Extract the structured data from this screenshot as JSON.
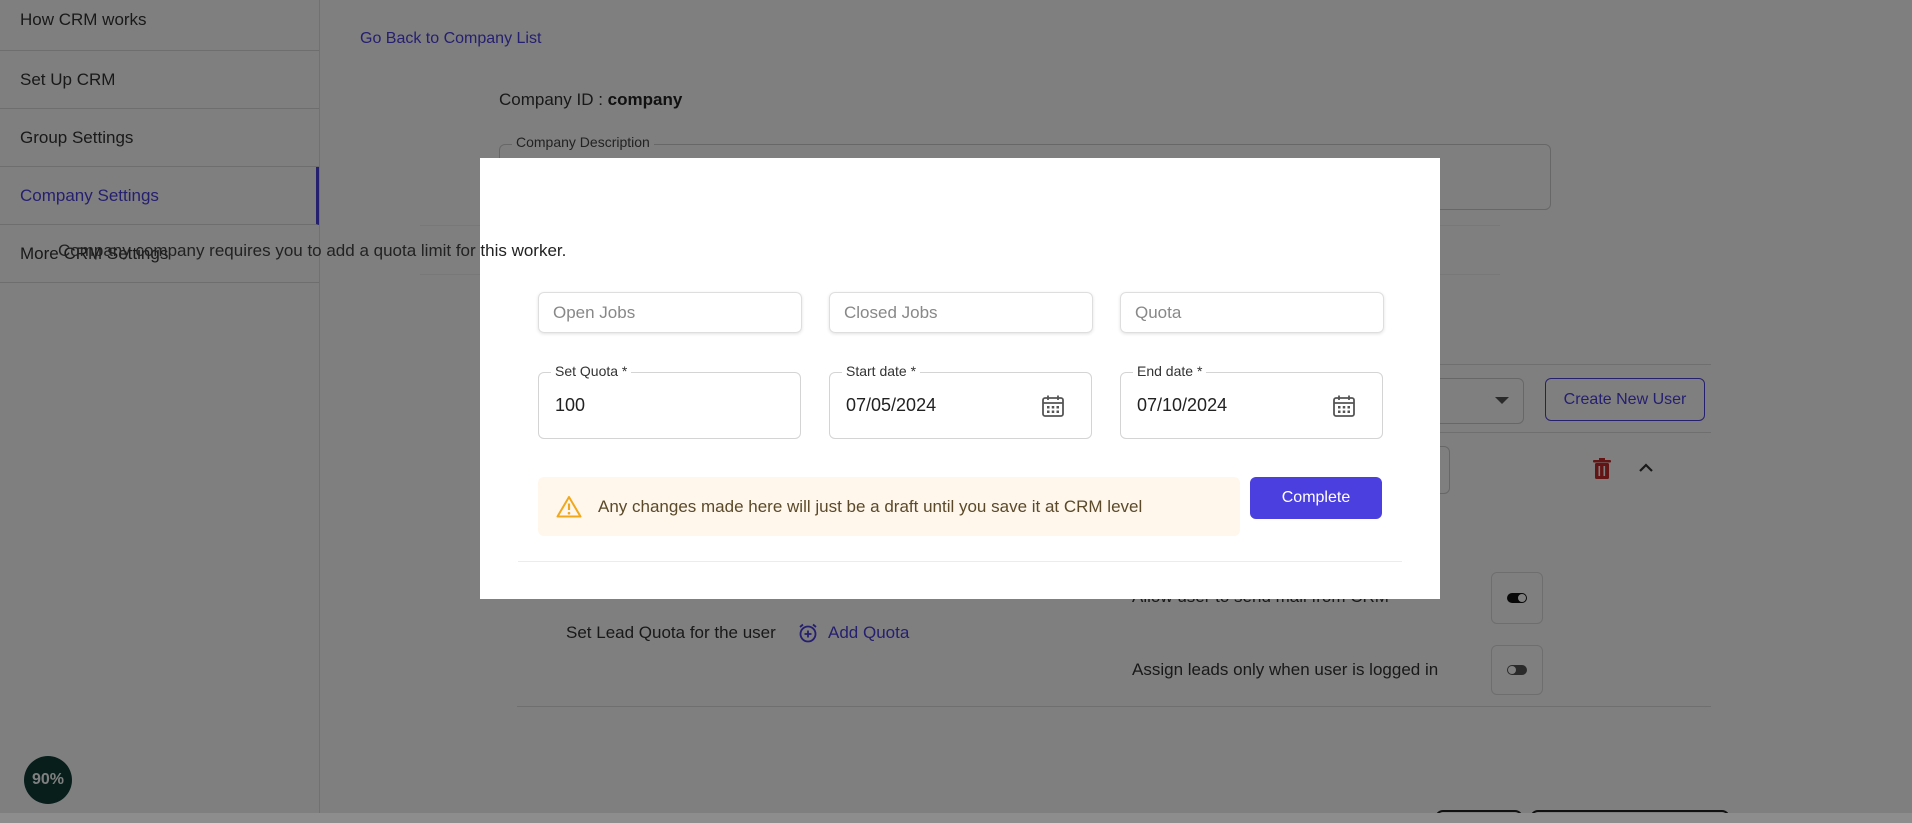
{
  "sidebar": {
    "items": [
      {
        "label": "How CRM works"
      },
      {
        "label": "Set Up CRM"
      },
      {
        "label": "Group Settings"
      },
      {
        "label": "Company Settings"
      },
      {
        "label": "More CRM Settings"
      }
    ],
    "active_index": 3
  },
  "zoom": "90%",
  "main": {
    "back_link": "Go Back to Company List",
    "company_id_label": "Company ID :",
    "company_id_value": "company",
    "description_label": "Company Description",
    "create_user": "Create New User",
    "lead_quota_label": "Set Lead Quota for the user",
    "add_quota": "Add Quota",
    "allow_mail": "Allow user to send mail from CRM",
    "assign_leads": "Assign leads only when user is logged in"
  },
  "modal": {
    "message": "Company company requires you to add a quota limit for this worker.",
    "open_jobs": "Open Jobs",
    "closed_jobs": "Closed Jobs",
    "quota": "Quota",
    "set_quota_label": "Set Quota *",
    "set_quota_value": "100",
    "start_label": "Start date *",
    "start_value": "07/05/2024",
    "end_label": "End date *",
    "end_value": "07/10/2024",
    "warning": "Any changes made here will just be a draft until you save it at CRM level",
    "complete": "Complete"
  },
  "colors": {
    "accent": "#4b3fe0",
    "warning_bg": "#fff7ec",
    "warning_icon": "#f0a81c",
    "danger": "#c62828"
  }
}
